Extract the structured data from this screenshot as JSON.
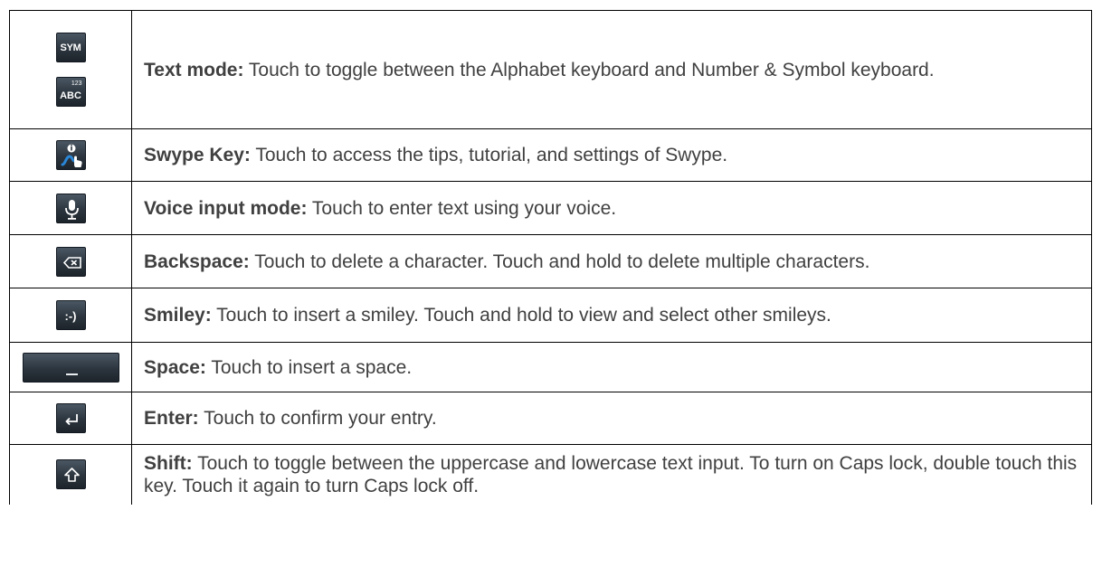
{
  "rows": [
    {
      "icon": "sym-abc-key-icons",
      "term": "Text mode:",
      "text": " Touch to toggle between the Alphabet keyboard and Number & Symbol keyboard."
    },
    {
      "icon": "swype-key-icon",
      "term": "Swype Key:",
      "text": " Touch to access the tips, tutorial, and settings of Swype."
    },
    {
      "icon": "microphone-key-icon",
      "term": "Voice input mode:",
      "text": " Touch to enter text using your voice."
    },
    {
      "icon": "backspace-key-icon",
      "term": "Backspace:",
      "text": " Touch to delete a character. Touch and hold to delete multiple characters."
    },
    {
      "icon": "smiley-key-icon",
      "term": "Smiley:",
      "text": " Touch to insert a smiley. Touch and hold to view and select other smileys."
    },
    {
      "icon": "space-key-icon",
      "term": "Space:",
      "text": " Touch to insert a space."
    },
    {
      "icon": "enter-key-icon",
      "term": "Enter:",
      "text": " Touch to confirm your entry."
    },
    {
      "icon": "shift-key-icon",
      "term": "Shift:",
      "text": " Touch to toggle between the uppercase and lowercase text input. To turn on Caps lock, double touch this key. Touch it again to turn Caps lock off."
    }
  ],
  "key_labels": {
    "sym": "SYM",
    "num": "123",
    "abc": "ABC",
    "smiley": ":-)"
  },
  "colors": {
    "key_dark": "#2c353e",
    "swype_blue": "#2a86d6",
    "text": "#404040"
  }
}
